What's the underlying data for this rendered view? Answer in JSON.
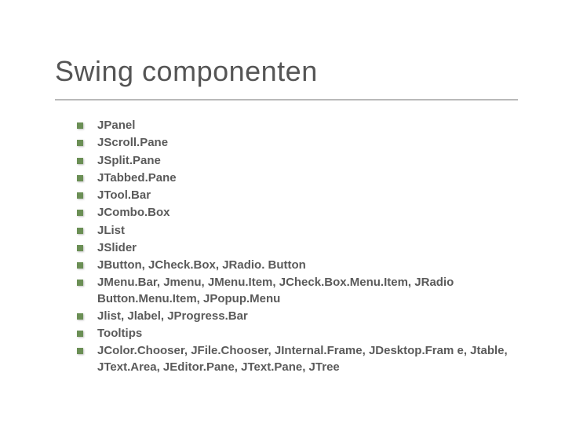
{
  "title": "Swing componenten",
  "bullets": [
    "JPanel",
    "JScroll.Pane",
    "JSplit.Pane",
    "JTabbed.Pane",
    "JTool.Bar",
    "JCombo.Box",
    "JList",
    "JSlider",
    "JButton, JCheck.Box, JRadio. Button",
    "JMenu.Bar, Jmenu, JMenu.Item, JCheck.Box.Menu.Item, JRadio Button.Menu.Item, JPopup.Menu",
    "Jlist, Jlabel, JProgress.Bar",
    "Tooltips",
    "JColor.Chooser, JFile.Chooser, JInternal.Frame, JDesktop.Fram e, Jtable, JText.Area, JEditor.Pane, JText.Pane, JTree"
  ]
}
